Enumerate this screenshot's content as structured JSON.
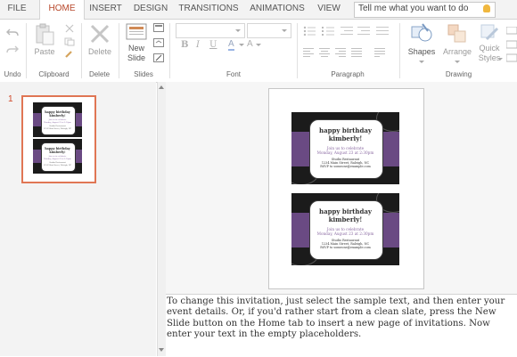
{
  "tabs": [
    {
      "label": "FILE",
      "active": false
    },
    {
      "label": "HOME",
      "active": true
    },
    {
      "label": "INSERT",
      "active": false
    },
    {
      "label": "DESIGN",
      "active": false
    },
    {
      "label": "TRANSITIONS",
      "active": false
    },
    {
      "label": "ANIMATIONS",
      "active": false
    },
    {
      "label": "VIEW",
      "active": false
    }
  ],
  "tell_me": {
    "text": "Tell me what you want to do",
    "icon": "lightbulb-icon"
  },
  "ribbon": {
    "groups": {
      "undo": "Undo",
      "clipboard": "Clipboard",
      "delete": "Delete",
      "slides": "Slides",
      "font": "Font",
      "paragraph": "Paragraph",
      "drawing": "Drawing"
    },
    "buttons": {
      "paste": "Paste",
      "delete": "Delete",
      "new_slide_line1": "New",
      "new_slide_line2": "Slide",
      "shapes": "Shapes",
      "arrange": "Arrange",
      "quick_styles_line1": "Quick",
      "quick_styles_line2": "Styles"
    }
  },
  "thumbnail": {
    "slide_number": "1"
  },
  "card": {
    "title_line1": "happy birthday",
    "title_line2": "kimberly!",
    "line1": "Join us to celebrate",
    "line2": "Monday, August 23 at 2:30pm",
    "venue": "Studio Restaurant",
    "address": "1234 Main Street, Raleigh, NC",
    "rsvp": "RSVP to someone@example.com"
  },
  "notes": {
    "text": "To change this invitation, just select the sample text, and then enter your event details. Or, if you'd rather start from a clean slate, press the New Slide button on the Home tab to insert a new page of invitations. Now enter your text in the empty placeholders."
  },
  "colors": {
    "accent": "#b7472a",
    "card_band": "#6a4a83",
    "card_bg": "#1b1b1b",
    "card_text_purple": "#8a6aa2"
  }
}
